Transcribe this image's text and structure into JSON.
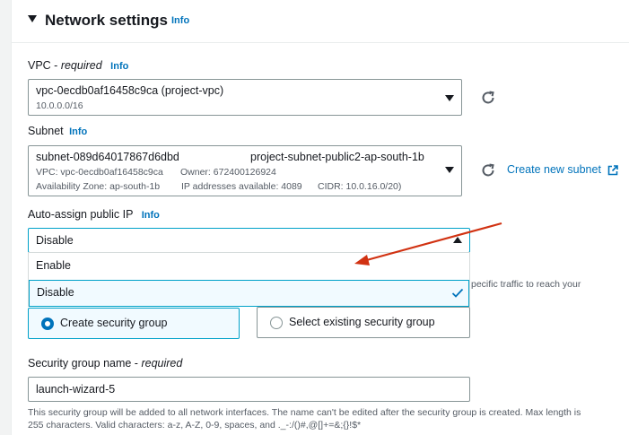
{
  "section": {
    "title": "Network settings",
    "info": "Info"
  },
  "vpc": {
    "label": "VPC - ",
    "required": "required",
    "info": "Info",
    "value": "vpc-0ecdb0af16458c9ca (project-vpc)",
    "cidr": "10.0.0.0/16"
  },
  "subnet": {
    "label": "Subnet",
    "info": "Info",
    "id": "subnet-089d64017867d6dbd",
    "name": "project-subnet-public2-ap-south-1b",
    "vpc": "VPC: vpc-0ecdb0af16458c9ca",
    "owner": "Owner: 672400126924",
    "az": "Availability Zone: ap-south-1b",
    "ips": "IP addresses available: 4089",
    "cidr": "CIDR: 10.0.16.0/20)",
    "create_link": "Create new subnet"
  },
  "public_ip": {
    "label": "Auto-assign public IP",
    "info": "Info",
    "value": "Disable",
    "options": [
      "Enable",
      "Disable"
    ],
    "hidden_text": "pecific traffic to reach your"
  },
  "firewall": {
    "create": "Create security group",
    "select": "Select existing security group"
  },
  "sg_name": {
    "label": "Security group name - ",
    "required": "required",
    "value": "launch-wizard-5",
    "helper_1": "This security group will be added to all network interfaces. The name can't be edited after the security group is created. Max length is",
    "helper_2": "255 characters. Valid characters: a-z, A-Z, 0-9, spaces, and ._-:/()#,@[]+=&;{}!$*"
  },
  "colors": {
    "link": "#0073bb",
    "arrow": "#d13212",
    "selected_border": "#00a1c9",
    "selected_bg": "#f1faff"
  },
  "icons": [
    "caret-down-icon",
    "refresh-icon",
    "external-link-icon",
    "checkmark-icon"
  ]
}
